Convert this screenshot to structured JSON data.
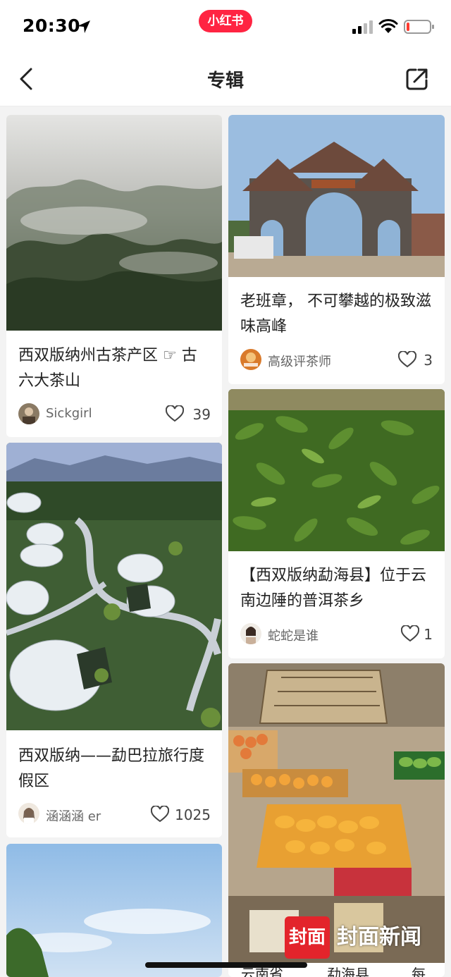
{
  "status_bar": {
    "time": "20:30",
    "app_badge": "小红书"
  },
  "navbar": {
    "title": "专辑"
  },
  "cards": [
    {
      "title": "西双版纳州古茶产区 ☞ 古六大茶山",
      "author": "Sickgirl",
      "likes": "39"
    },
    {
      "title": "老班章，  不可攀越的极致滋味高峰",
      "author": "高级评茶师",
      "likes": "3"
    },
    {
      "title": "【西双版纳勐海县】位于云南边陲的普洱茶乡",
      "author": "蛇蛇是谁",
      "likes": "1"
    },
    {
      "title": "西双版纳——勐巴拉旅行度假区",
      "author": "涵涵涵 er",
      "likes": "1025"
    }
  ],
  "watermark": {
    "box": "封面",
    "text": "封面新闻"
  },
  "bottom_labels": [
    "云南省",
    "勐海县",
    "每"
  ],
  "colors": {
    "brand": "#ff2442",
    "background": "#f3f3f3",
    "card": "#ffffff"
  }
}
